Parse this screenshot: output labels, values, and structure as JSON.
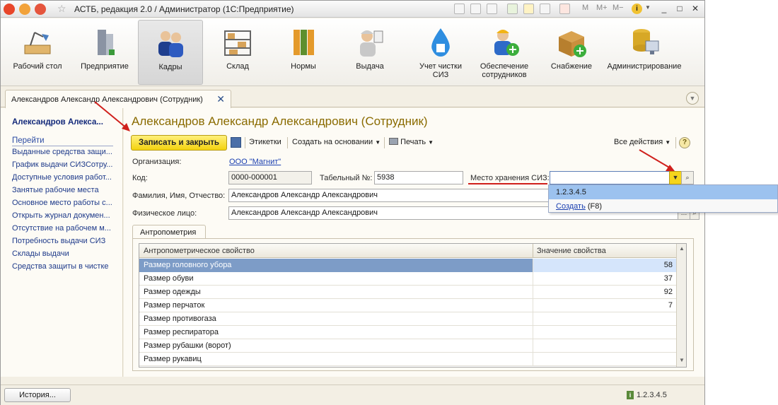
{
  "window": {
    "title": "АСТБ, редакция 2.0 / Администратор  (1С:Предприятие)",
    "right_tools": [
      "M",
      "M+",
      "M−"
    ]
  },
  "sections": [
    {
      "label": "Рабочий стол",
      "icon": "desk-lamp-icon"
    },
    {
      "label": "Предприятие",
      "icon": "building-icon"
    },
    {
      "label": "Кадры",
      "icon": "people-icon",
      "active": true
    },
    {
      "label": "Склад",
      "icon": "warehouse-shelves-icon"
    },
    {
      "label": "Нормы",
      "icon": "binders-icon"
    },
    {
      "label": "Выдача",
      "icon": "worker-icon"
    },
    {
      "label": "Учет чистки СИЗ",
      "icon": "water-drop-shirt-icon"
    },
    {
      "label": "Обеспечение сотрудников",
      "icon": "worker-plus-icon"
    },
    {
      "label": "Снабжение",
      "icon": "box-plus-icon"
    },
    {
      "label": "Администрирование",
      "icon": "database-computer-icon"
    }
  ],
  "doc_tab": {
    "label": "Александров Александр Александрович (Сотрудник)"
  },
  "nav": {
    "title": "Александров Алекса...",
    "goto_label": "Перейти",
    "items": [
      "Выданные средства защи...",
      "График выдачи СИЗСотру...",
      "Доступные условия работ...",
      "Занятые рабочие места",
      "Основное место работы с...",
      "Открыть журнал докумен...",
      "Отсутствие на рабочем м...",
      "Потребность выдачи СИЗ",
      "Склады выдачи",
      "Средства защиты в чистке"
    ]
  },
  "form": {
    "title": "Александров Александр Александрович (Сотрудник)",
    "toolbar": {
      "save_close": "Записать и закрыть",
      "labels": "Этикетки",
      "create_based": "Создать на основании",
      "print": "Печать",
      "all_actions": "Все действия"
    },
    "org_label": "Организация:",
    "org_value": "ООО \"Магнит\"",
    "code_label": "Код:",
    "code_value": "0000-000001",
    "tab_label": "Табельный №:",
    "tab_value": "5938",
    "storage_label": "Место хранения СИЗ:",
    "storage_value": "",
    "fio_label": "Фамилия, Имя, Отчество:",
    "fio_value": "Александров Александр Александрович",
    "person_label": "Физическое лицо:",
    "person_value": "Александров Александр Александрович"
  },
  "popup": {
    "item": "1.2.3.4.5",
    "create_link": "Создать",
    "create_hint": "(F8)"
  },
  "anthropometry": {
    "tab_label": "Антропометрия",
    "columns": [
      "Антропометрическое свойство",
      "Значение свойства"
    ],
    "rows": [
      {
        "name": "Размер головного убора",
        "value": "58"
      },
      {
        "name": "Размер обуви",
        "value": "37"
      },
      {
        "name": "Размер одежды",
        "value": "92"
      },
      {
        "name": "Размер перчаток",
        "value": "7"
      },
      {
        "name": "Размер противогаза",
        "value": ""
      },
      {
        "name": "Размер респиратора",
        "value": ""
      },
      {
        "name": "Размер рубашки (ворот)",
        "value": ""
      },
      {
        "name": "Размер рукавиц",
        "value": ""
      }
    ]
  },
  "status": {
    "history_button": "История...",
    "version": "1.2.3.4.5"
  },
  "colors": {
    "accent_title": "#8a6b00",
    "primary_button": "#f3d20f",
    "link": "#1a3fb0",
    "selection": "#7d9cc7",
    "annotation_red": "#d0201c"
  }
}
